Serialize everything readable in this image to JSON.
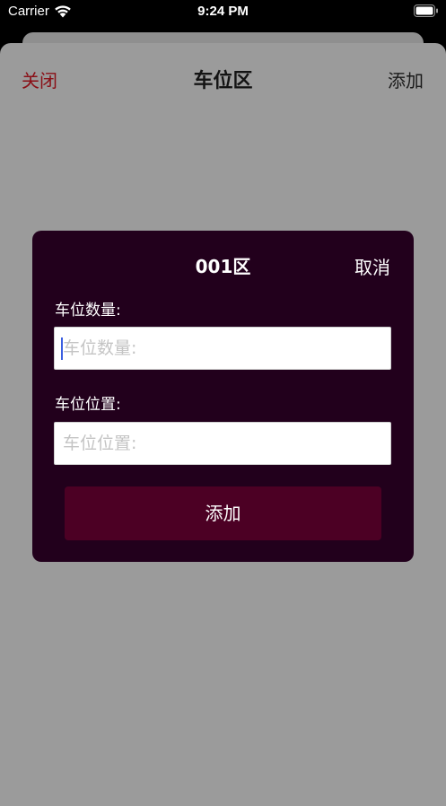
{
  "status_bar": {
    "carrier": "Carrier",
    "time": "9:24 PM"
  },
  "nav": {
    "close_label": "关闭",
    "title": "车位区",
    "add_label": "添加"
  },
  "dialog": {
    "title": "001区",
    "cancel_label": "取消",
    "fields": [
      {
        "label": "车位数量:",
        "value": "",
        "placeholder": "车位数量:"
      },
      {
        "label": "车位位置:",
        "value": "",
        "placeholder": "车位位置:"
      }
    ],
    "submit_label": "添加"
  },
  "colors": {
    "close_accent": "#8a0f16",
    "dialog_background": "#22001c",
    "submit_background": "#4c0024",
    "caret": "#3b5fe0"
  }
}
